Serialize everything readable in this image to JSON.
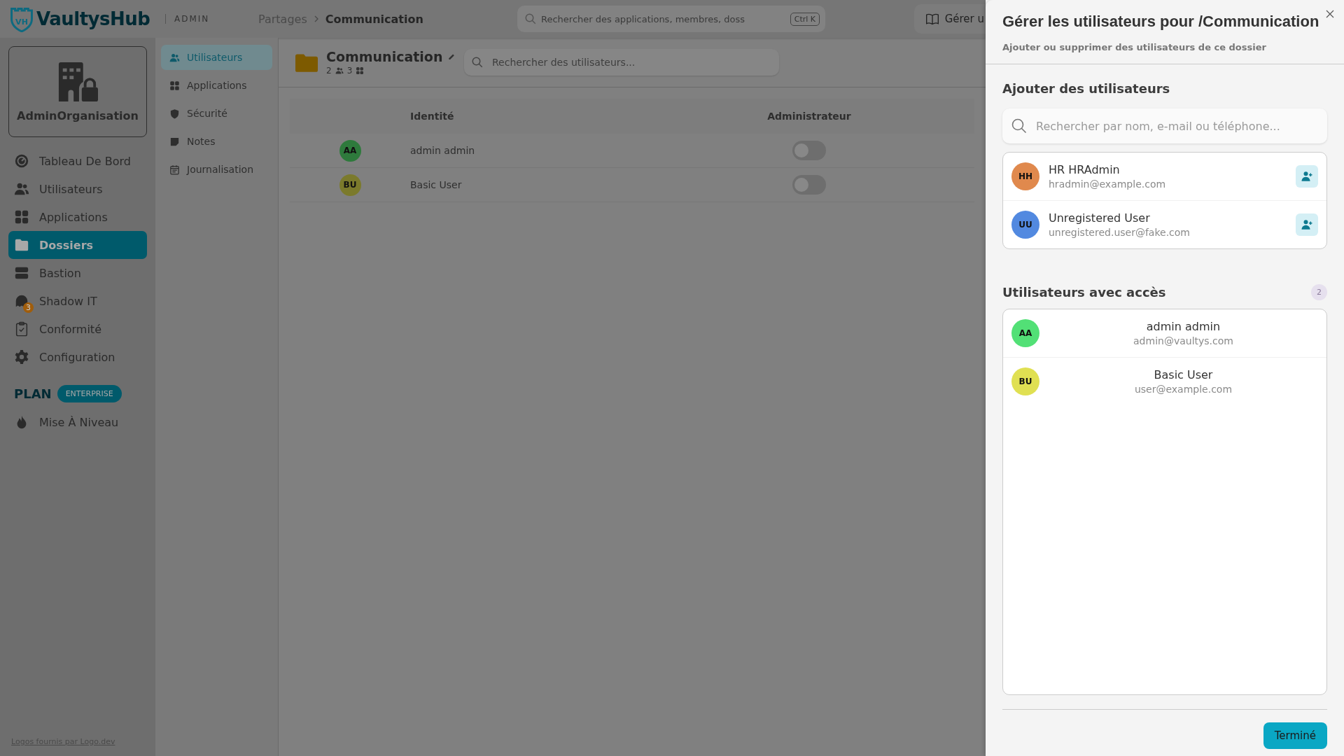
{
  "header": {
    "logo": {
      "mark": "VH",
      "name": "VaultysHub"
    },
    "section": "ADMIN",
    "breadcrumb": [
      "Partages",
      "Communication"
    ],
    "search": {
      "placeholder": "Rechercher des applications, membres, doss",
      "shortcut": "Ctrl K"
    },
    "button": "Gérer u"
  },
  "sidebar": {
    "organisation": "AdminOrganisation",
    "items": [
      {
        "label": "Tableau De Bord",
        "kind": "dashboard",
        "selected": false
      },
      {
        "label": "Utilisateurs",
        "kind": "users",
        "selected": false
      },
      {
        "label": "Applications",
        "kind": "apps",
        "selected": false
      },
      {
        "label": "Dossiers",
        "kind": "folder",
        "selected": true
      },
      {
        "label": "Bastion",
        "kind": "server",
        "selected": false
      },
      {
        "label": "Shadow IT",
        "kind": "ghost",
        "selected": false,
        "badge": "3"
      },
      {
        "label": "Conformité",
        "kind": "clipboard",
        "selected": false
      },
      {
        "label": "Configuration",
        "kind": "gear",
        "selected": false
      }
    ],
    "plan": {
      "label": "PLAN",
      "tier": "ENTERPRISE"
    },
    "upgrade": "Mise À Niveau",
    "footer_link": "Logos fournis par Logo.dev"
  },
  "subnav": [
    {
      "label": "Utilisateurs",
      "kind": "users",
      "selected": true
    },
    {
      "label": "Applications",
      "kind": "apps",
      "selected": false
    },
    {
      "label": "Sécurité",
      "kind": "shield",
      "selected": false
    },
    {
      "label": "Notes",
      "kind": "note",
      "selected": false
    },
    {
      "label": "Journalisation",
      "kind": "calendar",
      "selected": false
    }
  ],
  "folder": {
    "title": "Communication",
    "users_count": "2",
    "apps_count": "3",
    "search": {
      "placeholder": "Rechercher des utilisateurs..."
    }
  },
  "table": {
    "columns": [
      "Identité",
      "Administrateur"
    ],
    "rows": [
      {
        "initials": "AA",
        "color": "#2e7a3c",
        "name": "admin admin",
        "admin": false
      },
      {
        "initials": "BU",
        "color": "#7b7a2c",
        "name": "Basic User",
        "admin": false
      }
    ]
  },
  "panel": {
    "title": "Gérer les utilisateurs pour /Communication",
    "subtitle": "Ajouter ou supprimer des utilisateurs de ce dossier",
    "add_section": {
      "title": "Ajouter des utilisateurs",
      "search": {
        "placeholder": "Rechercher par nom, e-mail ou téléphone..."
      },
      "candidates": [
        {
          "initials": "HH",
          "color": "#e0894d",
          "name": "HR HRAdmin",
          "email": "hradmin@example.com"
        },
        {
          "initials": "UU",
          "color": "#5289e0",
          "name": "Unregistered User",
          "email": "unregistered.user@fake.com"
        }
      ]
    },
    "access_section": {
      "title": "Utilisateurs avec accès",
      "count": "2",
      "members": [
        {
          "initials": "AA",
          "color": "#52e076",
          "name": "admin admin",
          "email": "admin@vaultys.com"
        },
        {
          "initials": "BU",
          "color": "#e0e052",
          "name": "Basic User",
          "email": "user@example.com"
        }
      ]
    },
    "done_button": "Terminé"
  }
}
